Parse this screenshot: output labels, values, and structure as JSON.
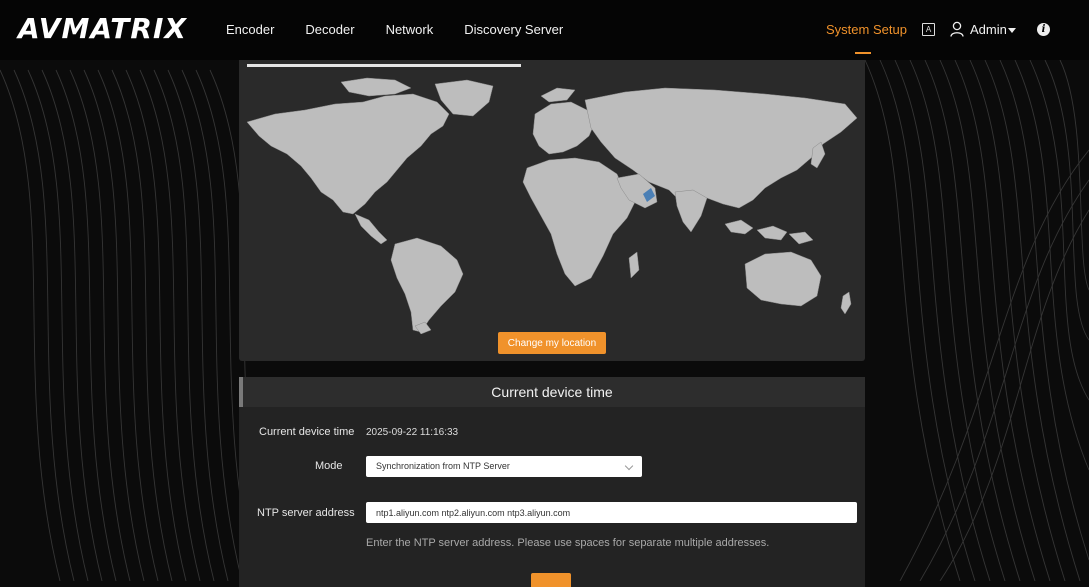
{
  "brand": {
    "logo_text_a": "AV",
    "logo_text_b": "MATRIX"
  },
  "nav": {
    "items": [
      "Encoder",
      "Decoder",
      "Network",
      "Discovery Server"
    ],
    "system_setup": "System Setup",
    "language_glyph": "A",
    "user": "Admin"
  },
  "map": {
    "change_location_label": "Change my location"
  },
  "device_time": {
    "title": "Current device time",
    "current_time_label": "Current device time",
    "current_time_value": "2025-09-22 11:16:33",
    "mode_label": "Mode",
    "mode_value": "Synchronization from NTP Server",
    "ntp_label": "NTP server address",
    "ntp_value": "ntp1.aliyun.com ntp2.aliyun.com ntp3.aliyun.com",
    "ntp_hint": "Enter the NTP server address. Please use spaces for separate multiple addresses."
  },
  "colors": {
    "accent": "#f0922b",
    "panel": "#2a2a2a",
    "map_land": "#bdbdbd",
    "map_highlight": "#4a7fb5"
  }
}
